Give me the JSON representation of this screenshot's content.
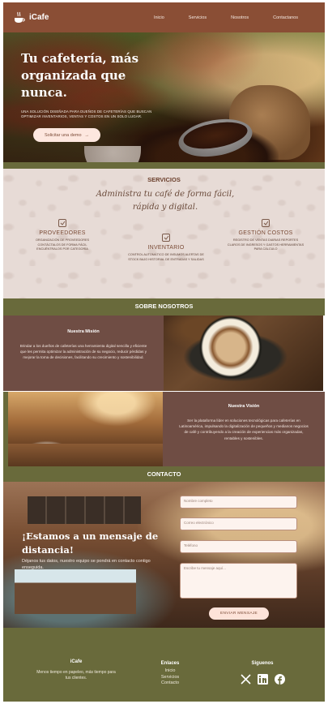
{
  "brand": {
    "name": "iCafe",
    "icon": "coffee-cup-icon"
  },
  "nav": {
    "links": [
      "Inicio",
      "Servicios",
      "Nosotros",
      "Contactanos"
    ]
  },
  "hero": {
    "title": "Tu cafetería, más organizada que nunca.",
    "subtitle": "Una solución diseñada para dueños de cafeterías que buscan optimizar inventarios, ventas y costos en un solo lugar.",
    "button_label": "Solicitar una demo",
    "button_arrow": "→"
  },
  "services": {
    "title": "SERVICIOS",
    "tagline": "Administra tu café de forma fácil, rápida y digital.",
    "items": [
      {
        "name": "PROVEEDORES",
        "desc": "Organización de proveedores contáctalos de forma fácil encuéntralos por categoría"
      },
      {
        "name": "INVENTARIO",
        "desc": "Control automático de insumos alertas de stock bajo historial de entradas y salidas"
      },
      {
        "name": "GESTIÓN COSTOS",
        "desc": "Registro de ventas diarias reportes claros de ingresos y gastos herramientas para cálculo"
      }
    ]
  },
  "about": {
    "title": "SOBRE NOSOTROS",
    "mission_title": "Nuestra Misión",
    "mission_text": "Brindar a los dueños de cafeterías una herramienta digital sencilla y eficiente que les permita optimizar la administración de su negocio, reducir pérdidas y mejorar la toma de decisiones, facilitando su crecimiento y sostenibilidad.",
    "vision_title": "Nuestra Visión",
    "vision_text": "Ser la plataforma líder en soluciones tecnológicas para cafeterías en Latinoamérica, impulsando la digitalización de pequeños y medianos negocios de café y contribuyendo a la creación de experiencias más organizadas, rentables y sostenibles."
  },
  "contact": {
    "title": "CONTACTO",
    "heading": "¡Estamos a un mensaje de distancia!",
    "subtext": "Déjanos tus datos, nuestro equipo se pondrá en contacto contigo enseguida.",
    "fields": [
      {
        "placeholder": "Nombre completo"
      },
      {
        "placeholder": "Correo electrónico"
      },
      {
        "placeholder": "Teléfono"
      }
    ],
    "message_placeholder": "Escribe tu mensaje aquí...",
    "send_label": "ENVIAR MENSAJE"
  },
  "footer": {
    "brand": "iCafe",
    "tagline": "Menos tiempo en papeleo, más tiempo para tus clientes.",
    "links_title": "Enlaces",
    "links": [
      "Inicio",
      "Servicios",
      "Contacto"
    ],
    "social_title": "Siguenos",
    "social_icons": [
      "x-icon",
      "linkedin-icon",
      "facebook-icon"
    ]
  },
  "colors": {
    "nav_brown": "#8a4e35",
    "olive": "#696a3b",
    "panel_brown": "#6f4d44",
    "button_pink": "#fde7df",
    "services_bg": "#e2d5cf"
  }
}
